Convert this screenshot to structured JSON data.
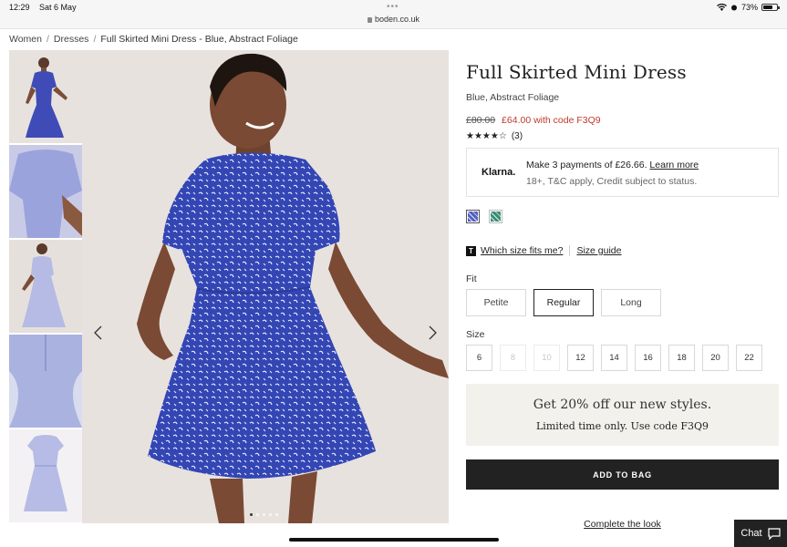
{
  "status": {
    "time": "12:29",
    "date": "Sat 6 May",
    "url": "boden.co.uk",
    "battery": "73%",
    "battery_level": 0.73
  },
  "breadcrumb": [
    "Women",
    "Dresses",
    "Full Skirted Mini Dress - Blue, Abstract Foliage"
  ],
  "product": {
    "title": "Full Skirted Mini Dress",
    "colour": "Blue, Abstract Foliage",
    "old_price": "£80.00",
    "new_price": "£64.00 with code F3Q9",
    "stars": "★★★★☆",
    "rating_value": 4.5,
    "review_count": "(3)"
  },
  "klarna": {
    "logo": "Klarna.",
    "line1": "Make 3 payments of £26.66.",
    "learn_more": "Learn more",
    "line2": "18+, T&C apply, Credit subject to status."
  },
  "swatches": [
    {
      "name": "Blue, Abstract Foliage",
      "color": "#5560c0",
      "selected": true
    },
    {
      "name": "Green print",
      "color": "#3a8f6e",
      "selected": false
    }
  ],
  "size_help": {
    "which_size": "Which size fits me?",
    "size_guide": "Size guide",
    "icon_letter": "T"
  },
  "fit": {
    "label": "Fit",
    "options": [
      "Petite",
      "Regular",
      "Long"
    ],
    "selected": "Regular"
  },
  "size": {
    "label": "Size",
    "options": [
      "6",
      "8",
      "10",
      "12",
      "14",
      "16",
      "18",
      "20",
      "22"
    ],
    "unavailable": [
      "8",
      "10"
    ]
  },
  "promo": {
    "headline": "Get 20% off our new styles.",
    "subline": "Limited time only. Use code F3Q9"
  },
  "add_to_bag": "ADD TO BAG",
  "complete_the_look": "Complete the look",
  "chat": "Chat",
  "colors": {
    "sale_red": "#c03a2b",
    "dark": "#222222",
    "promo_bg": "#f3f1ec",
    "dress_blue": "#3a48b8"
  },
  "gallery": {
    "image_count": 5,
    "active_index": 0
  }
}
